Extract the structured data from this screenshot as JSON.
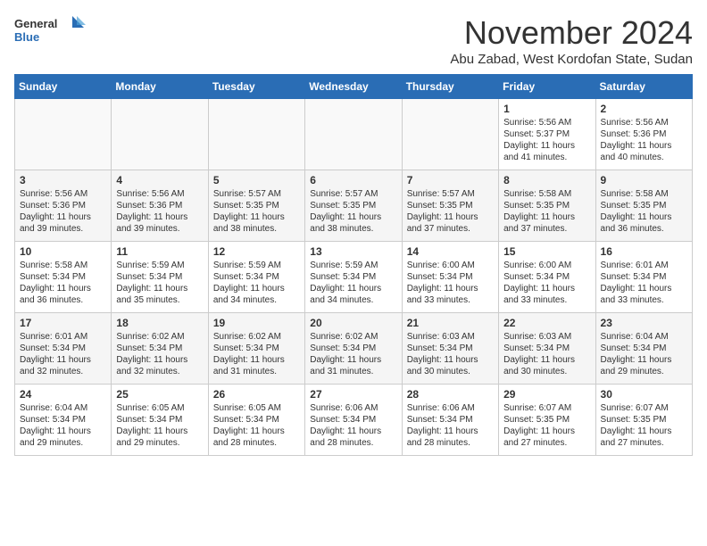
{
  "header": {
    "logo_line1": "General",
    "logo_line2": "Blue",
    "month_title": "November 2024",
    "subtitle": "Abu Zabad, West Kordofan State, Sudan"
  },
  "days_of_week": [
    "Sunday",
    "Monday",
    "Tuesday",
    "Wednesday",
    "Thursday",
    "Friday",
    "Saturday"
  ],
  "weeks": [
    [
      {
        "day": "",
        "info": ""
      },
      {
        "day": "",
        "info": ""
      },
      {
        "day": "",
        "info": ""
      },
      {
        "day": "",
        "info": ""
      },
      {
        "day": "",
        "info": ""
      },
      {
        "day": "1",
        "info": "Sunrise: 5:56 AM\nSunset: 5:37 PM\nDaylight: 11 hours\nand 41 minutes."
      },
      {
        "day": "2",
        "info": "Sunrise: 5:56 AM\nSunset: 5:36 PM\nDaylight: 11 hours\nand 40 minutes."
      }
    ],
    [
      {
        "day": "3",
        "info": "Sunrise: 5:56 AM\nSunset: 5:36 PM\nDaylight: 11 hours\nand 39 minutes."
      },
      {
        "day": "4",
        "info": "Sunrise: 5:56 AM\nSunset: 5:36 PM\nDaylight: 11 hours\nand 39 minutes."
      },
      {
        "day": "5",
        "info": "Sunrise: 5:57 AM\nSunset: 5:35 PM\nDaylight: 11 hours\nand 38 minutes."
      },
      {
        "day": "6",
        "info": "Sunrise: 5:57 AM\nSunset: 5:35 PM\nDaylight: 11 hours\nand 38 minutes."
      },
      {
        "day": "7",
        "info": "Sunrise: 5:57 AM\nSunset: 5:35 PM\nDaylight: 11 hours\nand 37 minutes."
      },
      {
        "day": "8",
        "info": "Sunrise: 5:58 AM\nSunset: 5:35 PM\nDaylight: 11 hours\nand 37 minutes."
      },
      {
        "day": "9",
        "info": "Sunrise: 5:58 AM\nSunset: 5:35 PM\nDaylight: 11 hours\nand 36 minutes."
      }
    ],
    [
      {
        "day": "10",
        "info": "Sunrise: 5:58 AM\nSunset: 5:34 PM\nDaylight: 11 hours\nand 36 minutes."
      },
      {
        "day": "11",
        "info": "Sunrise: 5:59 AM\nSunset: 5:34 PM\nDaylight: 11 hours\nand 35 minutes."
      },
      {
        "day": "12",
        "info": "Sunrise: 5:59 AM\nSunset: 5:34 PM\nDaylight: 11 hours\nand 34 minutes."
      },
      {
        "day": "13",
        "info": "Sunrise: 5:59 AM\nSunset: 5:34 PM\nDaylight: 11 hours\nand 34 minutes."
      },
      {
        "day": "14",
        "info": "Sunrise: 6:00 AM\nSunset: 5:34 PM\nDaylight: 11 hours\nand 33 minutes."
      },
      {
        "day": "15",
        "info": "Sunrise: 6:00 AM\nSunset: 5:34 PM\nDaylight: 11 hours\nand 33 minutes."
      },
      {
        "day": "16",
        "info": "Sunrise: 6:01 AM\nSunset: 5:34 PM\nDaylight: 11 hours\nand 33 minutes."
      }
    ],
    [
      {
        "day": "17",
        "info": "Sunrise: 6:01 AM\nSunset: 5:34 PM\nDaylight: 11 hours\nand 32 minutes."
      },
      {
        "day": "18",
        "info": "Sunrise: 6:02 AM\nSunset: 5:34 PM\nDaylight: 11 hours\nand 32 minutes."
      },
      {
        "day": "19",
        "info": "Sunrise: 6:02 AM\nSunset: 5:34 PM\nDaylight: 11 hours\nand 31 minutes."
      },
      {
        "day": "20",
        "info": "Sunrise: 6:02 AM\nSunset: 5:34 PM\nDaylight: 11 hours\nand 31 minutes."
      },
      {
        "day": "21",
        "info": "Sunrise: 6:03 AM\nSunset: 5:34 PM\nDaylight: 11 hours\nand 30 minutes."
      },
      {
        "day": "22",
        "info": "Sunrise: 6:03 AM\nSunset: 5:34 PM\nDaylight: 11 hours\nand 30 minutes."
      },
      {
        "day": "23",
        "info": "Sunrise: 6:04 AM\nSunset: 5:34 PM\nDaylight: 11 hours\nand 29 minutes."
      }
    ],
    [
      {
        "day": "24",
        "info": "Sunrise: 6:04 AM\nSunset: 5:34 PM\nDaylight: 11 hours\nand 29 minutes."
      },
      {
        "day": "25",
        "info": "Sunrise: 6:05 AM\nSunset: 5:34 PM\nDaylight: 11 hours\nand 29 minutes."
      },
      {
        "day": "26",
        "info": "Sunrise: 6:05 AM\nSunset: 5:34 PM\nDaylight: 11 hours\nand 28 minutes."
      },
      {
        "day": "27",
        "info": "Sunrise: 6:06 AM\nSunset: 5:34 PM\nDaylight: 11 hours\nand 28 minutes."
      },
      {
        "day": "28",
        "info": "Sunrise: 6:06 AM\nSunset: 5:34 PM\nDaylight: 11 hours\nand 28 minutes."
      },
      {
        "day": "29",
        "info": "Sunrise: 6:07 AM\nSunset: 5:35 PM\nDaylight: 11 hours\nand 27 minutes."
      },
      {
        "day": "30",
        "info": "Sunrise: 6:07 AM\nSunset: 5:35 PM\nDaylight: 11 hours\nand 27 minutes."
      }
    ]
  ]
}
